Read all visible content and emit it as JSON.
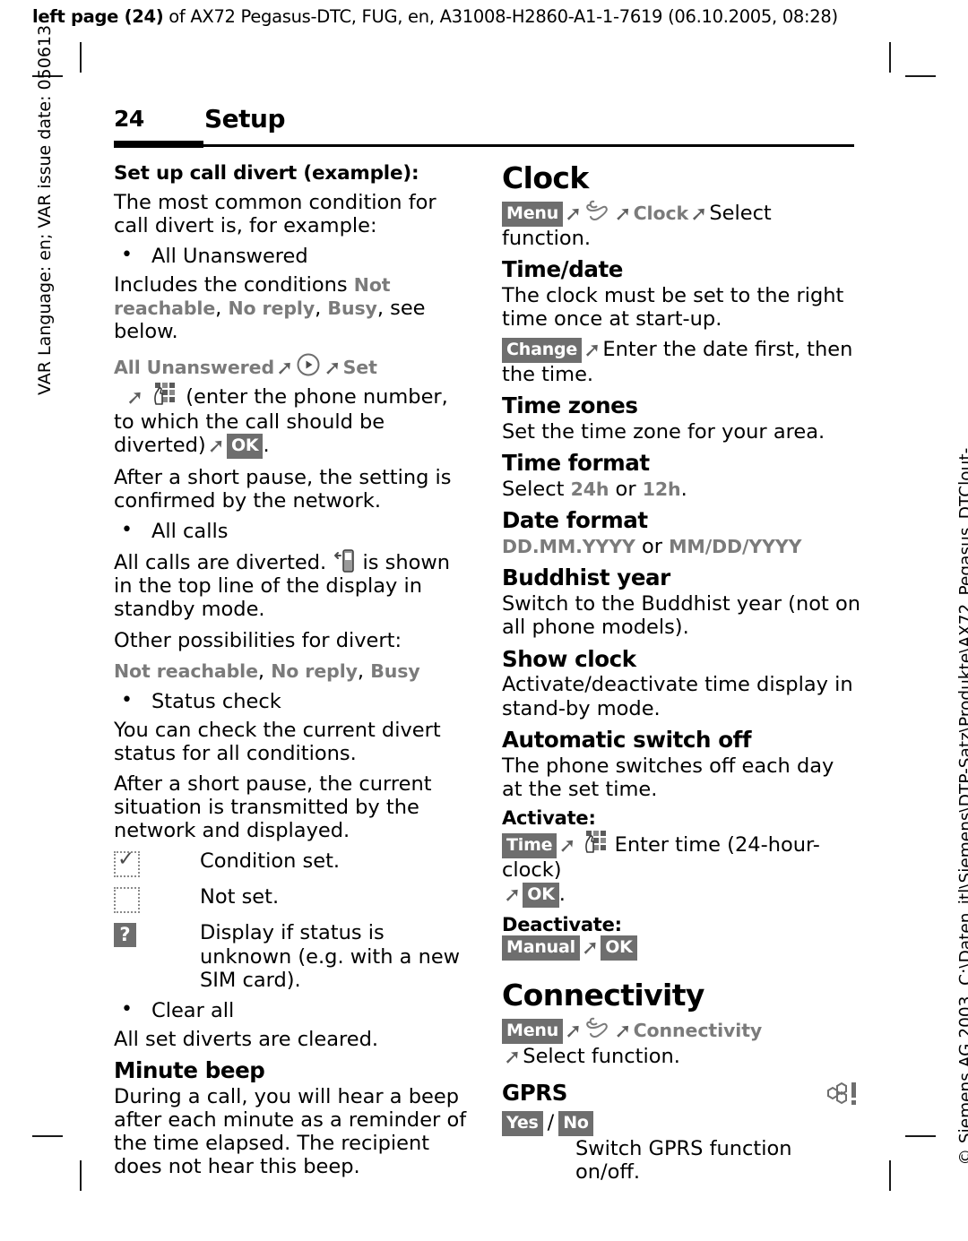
{
  "running_header": {
    "bold_prefix": "left page (24)",
    "rest": " of AX72 Pegasus-DTC, FUG, en, A31008-H2860-A1-1-7619 (06.10.2005, 08:28)"
  },
  "side_left": "VAR Language: en; VAR issue date: 050613",
  "side_right": "© Siemens AG 2003, C:\\Daten_itl\\Siemens\\DTP-Satz\\Produkte\\AX72_Pegasus_DTClout-",
  "page_head": {
    "page_number": "24",
    "chapter": "Setup"
  },
  "left_column": {
    "lead": "Set up call divert (example):",
    "p1": "The most common condition for call divert is, for example:",
    "bullet1": "All Unanswered",
    "p2_a": "Includes the conditions ",
    "p2_ui1": "Not reachable",
    "p2_b": ", ",
    "p2_ui2": "No reply",
    "p2_c": ", ",
    "p2_ui3": "Busy",
    "p2_d": ", see below.",
    "path_ui1": "All Unanswered",
    "path_ui2": "Set",
    "path_text1": "(enter the phone number, to which the call should be diverted)",
    "path_key_ok": "OK",
    "path_end": ".",
    "p3": "After a short pause, the setting is confirmed by the network.",
    "bullet2": "All calls",
    "p4_a": "All calls are diverted. ",
    "p4_b": " is shown in the top line of the display in standby mode.",
    "p5": "Other possibilities for divert:",
    "p6_ui1": "Not reachable",
    "p6_sep1": ", ",
    "p6_ui2": "No reply",
    "p6_sep2": ", ",
    "p6_ui3": "Busy",
    "bullet3": "Status check",
    "p7": "You can check the current divert status for all conditions.",
    "p8": "After a short pause, the current situation is transmitted by the network and displayed.",
    "status_rows": [
      {
        "icon": "checkbox-checked-dotted-icon",
        "text": "Condition set."
      },
      {
        "icon": "checkbox-empty-dotted-icon",
        "text": "Not set."
      },
      {
        "icon": "question-mark-box-icon",
        "text": "Display if status is unknown (e.g. with a new SIM card)."
      }
    ],
    "bullet4": "Clear all",
    "p9": "All set diverts are cleared.",
    "h2_minute_beep": "Minute beep",
    "p10": "During a call, you will hear a beep after each minute as a reminder of the time elapsed. The recipient does not hear this beep."
  },
  "right_column": {
    "h1_clock": "Clock",
    "clock_path_key": "Menu",
    "clock_path_ui": "Clock",
    "clock_path_text": "Select function.",
    "h2_time_date": "Time/date",
    "p_time_date": "The clock must be set to the right time once at start-up.",
    "change_key": "Change",
    "change_text": "Enter the date first, then the time.",
    "h2_time_zones": "Time zones",
    "p_time_zones": "Set the time zone for your area.",
    "h2_time_format": "Time format",
    "time_format_a": "Select ",
    "time_format_ui1": "24h",
    "time_format_b": " or ",
    "time_format_ui2": "12h",
    "time_format_c": ".",
    "h2_date_format": "Date format",
    "date_format_ui1": "DD.MM.YYYY",
    "date_format_mid": " or ",
    "date_format_ui2": "MM/DD/YYYY",
    "h2_buddhist": "Buddhist year",
    "p_buddhist": "Switch to the Buddhist year (not on all phone models).",
    "h2_show_clock": "Show clock",
    "p_show_clock": "Activate/deactivate time display in stand-by mode.",
    "h2_auto_off": "Automatic switch off",
    "p_auto_off": "The phone switches off each day at the set time.",
    "h3_activate": "Activate:",
    "activate_key_time": "Time",
    "activate_text": "Enter time (24-hour-clock)",
    "activate_key_ok": "OK",
    "activate_end": ".",
    "h3_deactivate": "Deactivate:",
    "deactivate_key_manual": "Manual",
    "deactivate_key_ok": "OK",
    "h1_connectivity": "Connectivity",
    "conn_path_key": "Menu",
    "conn_path_ui": "Connectivity",
    "conn_path_text": "Select function.",
    "h2_gprs": "GPRS",
    "gprs_key_yes": "Yes",
    "gprs_sep": "/",
    "gprs_key_no": "No",
    "gprs_text": "Switch GPRS function on/off."
  },
  "colors": {
    "key_bg": "#6e6e6e",
    "ui_term": "#7b7b7b",
    "rule": "#000000"
  }
}
